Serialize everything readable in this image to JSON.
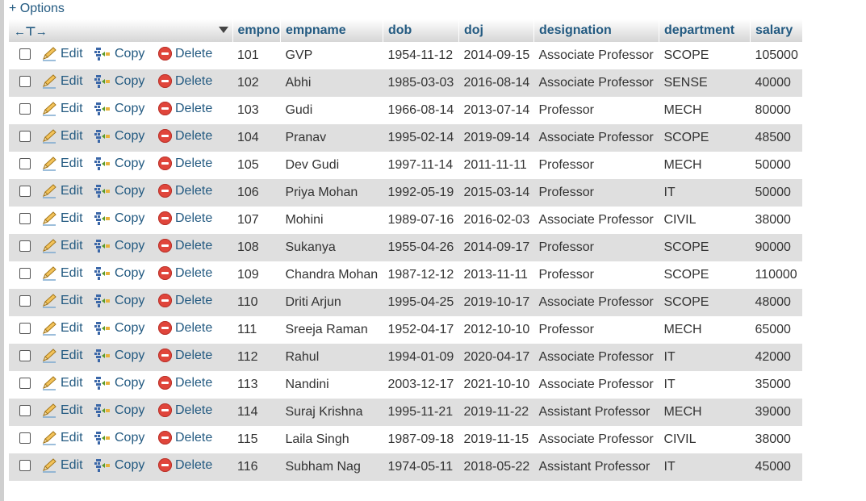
{
  "options_label": "+ Options",
  "action_labels": {
    "edit": "Edit",
    "copy": "Copy",
    "delete": "Delete"
  },
  "columns": [
    "empno",
    "empname",
    "dob",
    "doj",
    "designation",
    "department",
    "salary"
  ],
  "colors": {
    "link": "#235a81",
    "row_even": "#dfdfdf",
    "row_odd": "#ffffff",
    "delete_icon": "#e0453b"
  },
  "rows": [
    [
      "101",
      "GVP",
      "1954-11-12",
      "2014-09-15",
      "Associate Professor",
      "SCOPE",
      "105000"
    ],
    [
      "102",
      "Abhi",
      "1985-03-03",
      "2016-08-14",
      "Associate Professor",
      "SENSE",
      "40000"
    ],
    [
      "103",
      "Gudi",
      "1966-08-14",
      "2013-07-14",
      "Professor",
      "MECH",
      "80000"
    ],
    [
      "104",
      "Pranav",
      "1995-02-14",
      "2019-09-14",
      "Associate Professor",
      "SCOPE",
      "48500"
    ],
    [
      "105",
      "Dev Gudi",
      "1997-11-14",
      "2011-11-11",
      "Professor",
      "MECH",
      "50000"
    ],
    [
      "106",
      "Priya Mohan",
      "1992-05-19",
      "2015-03-14",
      "Professor",
      "IT",
      "50000"
    ],
    [
      "107",
      "Mohini",
      "1989-07-16",
      "2016-02-03",
      "Associate Professor",
      "CIVIL",
      "38000"
    ],
    [
      "108",
      "Sukanya",
      "1955-04-26",
      "2014-09-17",
      "Professor",
      "SCOPE",
      "90000"
    ],
    [
      "109",
      "Chandra Mohan",
      "1987-12-12",
      "2013-11-11",
      "Professor",
      "SCOPE",
      "110000"
    ],
    [
      "110",
      "Driti Arjun",
      "1995-04-25",
      "2019-10-17",
      "Associate Professor",
      "SCOPE",
      "48000"
    ],
    [
      "111",
      "Sreeja Raman",
      "1952-04-17",
      "2012-10-10",
      "Professor",
      "MECH",
      "65000"
    ],
    [
      "112",
      "Rahul",
      "1994-01-09",
      "2020-04-17",
      "Associate Professor",
      "IT",
      "42000"
    ],
    [
      "113",
      "Nandini",
      "2003-12-17",
      "2021-10-10",
      "Associate Professor",
      "IT",
      "35000"
    ],
    [
      "114",
      "Suraj Krishna",
      "1995-11-21",
      "2019-11-22",
      "Assistant Professor",
      "MECH",
      "39000"
    ],
    [
      "115",
      "Laila Singh",
      "1987-09-18",
      "2019-11-15",
      "Associate Professor",
      "CIVIL",
      "38000"
    ],
    [
      "116",
      "Subham Nag",
      "1974-05-11",
      "2018-05-22",
      "Assistant Professor",
      "IT",
      "45000"
    ]
  ]
}
